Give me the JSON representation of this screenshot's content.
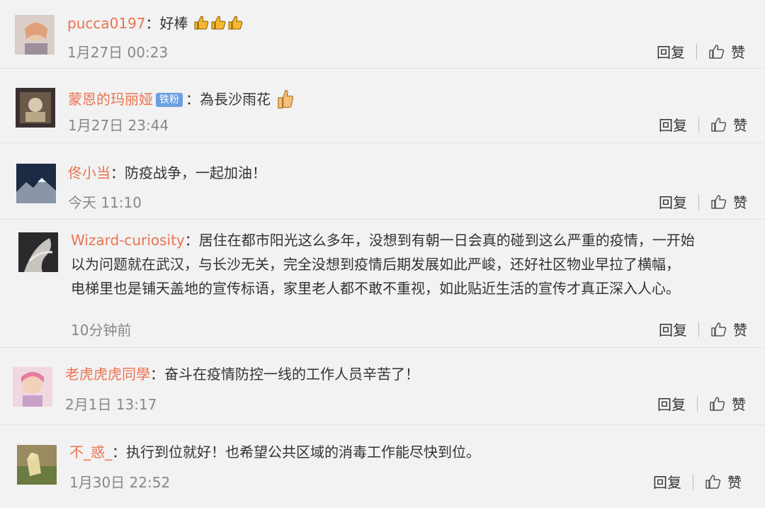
{
  "comments": [
    {
      "user": "pucca0197",
      "badge": "",
      "colon": "：",
      "text": "好棒",
      "emoji": "thumbs-up-x3",
      "time": "1月27日 00:23",
      "reply": "回复",
      "like": "赞"
    },
    {
      "user": "蒙恩的玛丽娅",
      "badge": "铁粉",
      "colon": "：",
      "text": "為長沙雨花",
      "emoji": "thumbs-up-hand",
      "time": "1月27日 23:44",
      "reply": "回复",
      "like": "赞"
    },
    {
      "user": "佟小当",
      "badge": "",
      "colon": "：",
      "text": "防疫战争，一起加油！",
      "emoji": "",
      "time": "今天 11:10",
      "reply": "回复",
      "like": "赞"
    },
    {
      "user": "Wizard-curiosity",
      "badge": "",
      "colon": "：",
      "text_line1": "居住在都市阳光这么多年，没想到有朝一日会真的碰到这么严重的疫情，一开始",
      "text_line2": "以为问题就在武汉，与长沙无关，完全没想到疫情后期发展如此严峻，还好社区物业早拉了横幅，",
      "text_line3": "电梯里也是铺天盖地的宣传标语，家里老人都不敢不重视，如此贴近生活的宣传才真正深入人心。",
      "time": "10分钟前",
      "reply": "回复",
      "like": "赞"
    },
    {
      "user": "老虎虎虎同學",
      "badge": "",
      "colon": "：",
      "text": "奋斗在疫情防控一线的工作人员辛苦了！",
      "emoji": "",
      "time": "2月1日 13:17",
      "reply": "回复",
      "like": "赞"
    },
    {
      "user": "不_惑_",
      "badge": "",
      "colon": "：",
      "text": "执行到位就好！也希望公共区域的消毒工作能尽快到位。",
      "emoji": "",
      "time": "1月30日 22:52",
      "reply": "回复",
      "like": "赞"
    }
  ],
  "colors": {
    "username": "#eb7350",
    "time": "#888888",
    "badge": "#6aa0e0"
  }
}
